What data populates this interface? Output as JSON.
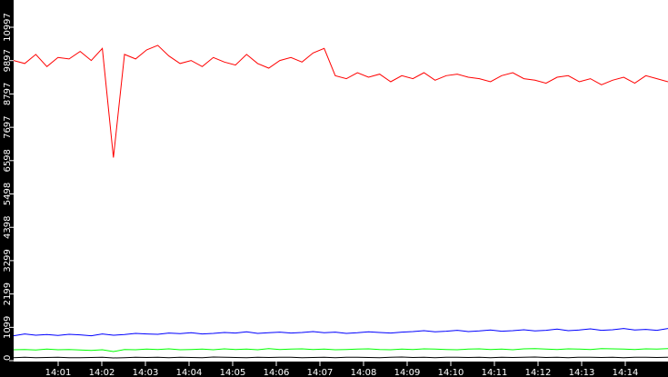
{
  "chart_data": {
    "type": "line",
    "title": "",
    "xlabel": "",
    "ylabel": "",
    "ylim": [
      0,
      10997
    ],
    "xlim_minutes": [
      0,
      15
    ],
    "y_ticks": [
      "0",
      "1099",
      "2199",
      "3299",
      "4398",
      "5498",
      "6598",
      "7697",
      "8797",
      "9897",
      "10997"
    ],
    "y_tick_values": [
      0,
      1099,
      2199,
      3299,
      4398,
      5498,
      6598,
      7697,
      8797,
      9897,
      10997
    ],
    "x_ticks": [
      "14:01",
      "14:02",
      "14:03",
      "14:04",
      "14:05",
      "14:06",
      "14:07",
      "14:08",
      "14:09",
      "14:10",
      "14:11",
      "14:12",
      "14:13",
      "14:14"
    ],
    "x_tick_minutes": [
      1,
      2,
      3,
      4,
      5,
      6,
      7,
      8,
      9,
      10,
      11,
      12,
      13,
      14
    ],
    "grid": false,
    "series": [
      {
        "name": "red",
        "color": "#ff0000",
        "values": [
          9900,
          9800,
          10100,
          9700,
          10000,
          9950,
          10200,
          9900,
          10300,
          6700,
          10100,
          9950,
          10250,
          10400,
          10050,
          9800,
          9900,
          9700,
          10000,
          9850,
          9750,
          10100,
          9800,
          9650,
          9900,
          10000,
          9850,
          10150,
          10300,
          9400,
          9300,
          9500,
          9350,
          9450,
          9200,
          9400,
          9300,
          9500,
          9250,
          9400,
          9450,
          9350,
          9300,
          9200,
          9400,
          9500,
          9300,
          9250,
          9150,
          9350,
          9400,
          9200,
          9300,
          9100,
          9250,
          9350,
          9150,
          9400,
          9300,
          9200
        ]
      },
      {
        "name": "blue",
        "color": "#0000ff",
        "values": [
          820,
          880,
          840,
          860,
          830,
          870,
          850,
          820,
          880,
          840,
          860,
          900,
          880,
          870,
          910,
          890,
          920,
          880,
          900,
          930,
          910,
          950,
          900,
          920,
          940,
          910,
          930,
          960,
          920,
          940,
          900,
          920,
          950,
          930,
          910,
          940,
          960,
          990,
          950,
          970,
          1000,
          960,
          980,
          1010,
          970,
          990,
          1020,
          980,
          1000,
          1040,
          990,
          1010,
          1050,
          1000,
          1020,
          1060,
          1010,
          1030,
          1000,
          1060
        ]
      },
      {
        "name": "green",
        "color": "#00ff00",
        "values": [
          360,
          370,
          350,
          380,
          360,
          370,
          350,
          340,
          360,
          300,
          370,
          360,
          380,
          370,
          390,
          360,
          370,
          380,
          360,
          390,
          370,
          380,
          360,
          400,
          370,
          380,
          390,
          370,
          380,
          360,
          370,
          380,
          390,
          370,
          360,
          380,
          370,
          390,
          380,
          370,
          360,
          380,
          390,
          370,
          380,
          360,
          390,
          400,
          380,
          370,
          390,
          380,
          370,
          400,
          390,
          380,
          370,
          390,
          380,
          400
        ]
      },
      {
        "name": "black",
        "color": "#000000",
        "values": [
          100,
          110,
          95,
          105,
          110,
          100,
          95,
          105,
          110,
          90,
          100,
          110,
          105,
          115,
          100,
          110,
          105,
          100,
          120,
          110,
          105,
          100,
          110,
          105,
          115,
          110,
          100,
          105,
          110,
          100,
          115,
          110,
          105,
          100,
          110,
          120,
          105,
          110,
          100,
          115,
          110,
          105,
          110,
          100,
          115,
          105,
          110,
          120,
          105,
          110,
          100,
          115,
          110,
          105,
          110,
          100,
          115,
          110,
          105,
          110
        ]
      }
    ]
  }
}
